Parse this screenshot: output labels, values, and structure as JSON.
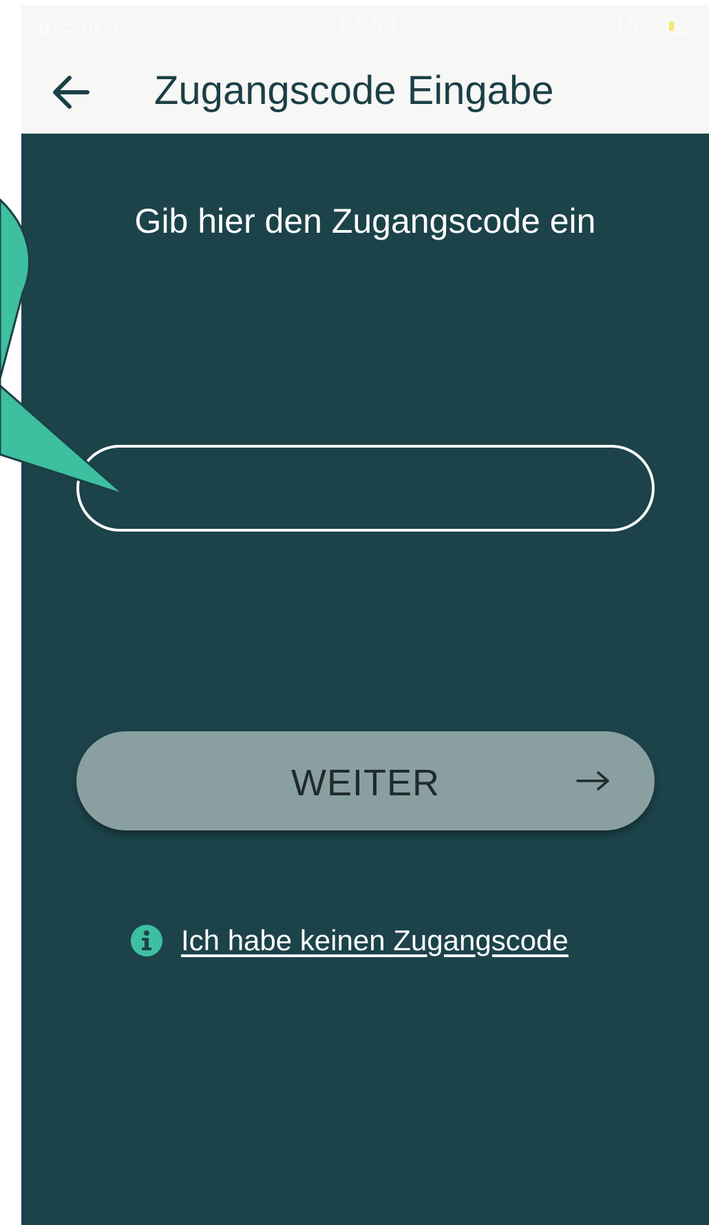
{
  "status_bar": {
    "carrier": "Salt",
    "network": "4G",
    "time": "14:58",
    "battery": "15%"
  },
  "app_bar": {
    "title": "Zugangscode Eingabe",
    "back_icon": "arrow-left-icon"
  },
  "main": {
    "prompt": "Gib hier den Zugangscode ein",
    "code_input": {
      "value": "",
      "placeholder": ""
    },
    "continue_button": {
      "label": "WEITER",
      "icon": "arrow-right-icon"
    },
    "no_code_link": {
      "label": "Ich habe keinen Zugangscode",
      "icon": "info-icon"
    }
  },
  "colors": {
    "background": "#1c434a",
    "app_bar": "#f7f7f5",
    "title": "#1c3f46",
    "button": "#8a9fa0",
    "accent": "#3dbfa0"
  }
}
